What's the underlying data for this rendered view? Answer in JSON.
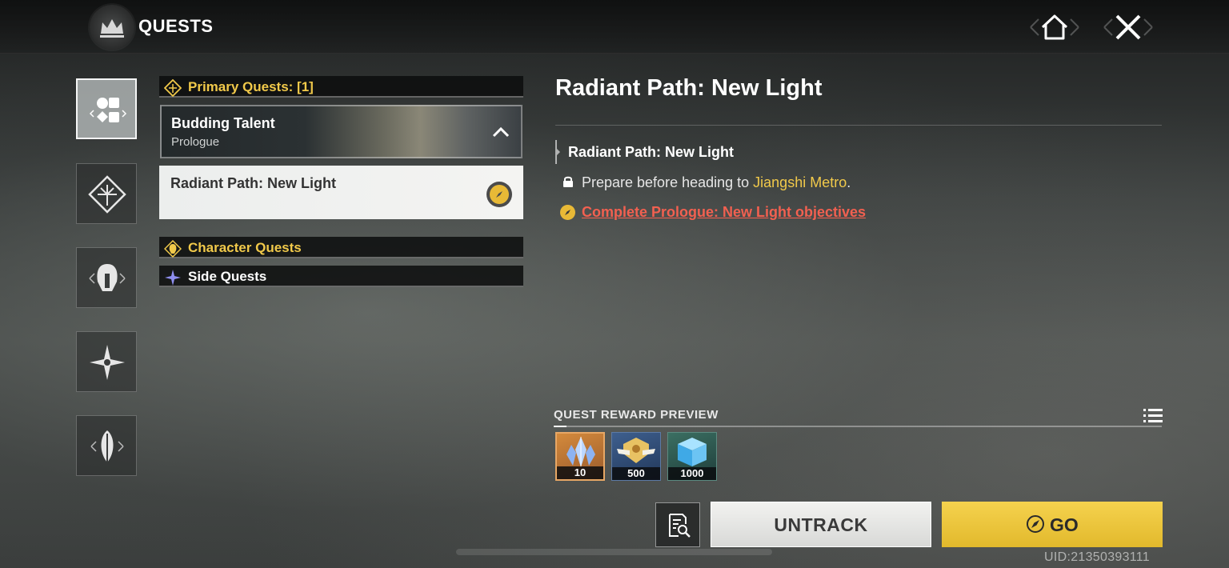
{
  "header": {
    "title": "QUESTS"
  },
  "categories": [
    {
      "name": "all-quests",
      "active": true
    },
    {
      "name": "primary-quests",
      "active": false
    },
    {
      "name": "character-quests",
      "active": false
    },
    {
      "name": "side-quests",
      "active": false
    },
    {
      "name": "misc-quests",
      "active": false
    }
  ],
  "quest_list": {
    "primary_header": "Primary Quests: [1]",
    "budding": {
      "title": "Budding Talent",
      "subtitle": "Prologue"
    },
    "radiant": {
      "title": "Radiant Path: New Light"
    },
    "character_header": "Character Quests",
    "side_header": "Side Quests"
  },
  "detail": {
    "title": "Radiant Path: New Light",
    "objective_title": "Radiant Path: New Light",
    "step_prefix": "Prepare before heading to ",
    "step_location": "Jiangshi Metro",
    "step_suffix": ".",
    "link_text": "Complete Prologue: New Light objectives"
  },
  "rewards": {
    "header": "QUEST REWARD PREVIEW",
    "items": [
      {
        "icon": "crystal-icon",
        "qty": "10"
      },
      {
        "icon": "emblem-icon",
        "qty": "500"
      },
      {
        "icon": "cube-icon",
        "qty": "1000"
      }
    ]
  },
  "actions": {
    "untrack": "UNTRACK",
    "go": "GO"
  },
  "uid": "UID:21350393111",
  "colors": {
    "gold": "#f1c94a",
    "link_red": "#f26050",
    "go_button": "#f0cb45"
  }
}
